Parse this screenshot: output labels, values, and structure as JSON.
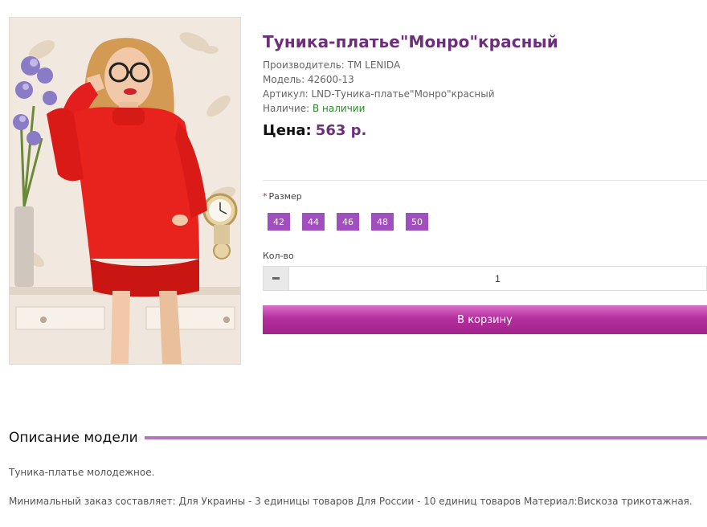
{
  "product": {
    "title": "Туника-платье\"Монро\"красный",
    "manufacturer_line": "Производитель: TM LENIDA",
    "model_line": "Модель: 42600-13",
    "article_line": "Артикул: LND-Туника-платье\"Монро\"красный",
    "availability_label": "Наличие:",
    "availability_value": "В наличии",
    "price_label": "Цена:",
    "price_value": "563 р.",
    "colors": {
      "accent": "#6e2f7a",
      "size_button": "#a14fbf",
      "cart": "#b52e9e",
      "in_stock": "#2b8a2b"
    }
  },
  "options": {
    "required_mark": "*",
    "size_label": "Размер",
    "sizes": [
      "42",
      "44",
      "46",
      "48",
      "50"
    ]
  },
  "quantity": {
    "label": "Кол-во",
    "value": "1",
    "minus_icon": "minus-icon"
  },
  "cart": {
    "button_label": "В корзину"
  },
  "description": {
    "heading": "Описание модели",
    "paragraph1": "Туника-платье молодежное.",
    "paragraph2": "Минимальный заказ составляет: Для Украины - 3 единицы товаров Для России - 10 единиц товаров Материал:Вискоза трикотажная."
  }
}
